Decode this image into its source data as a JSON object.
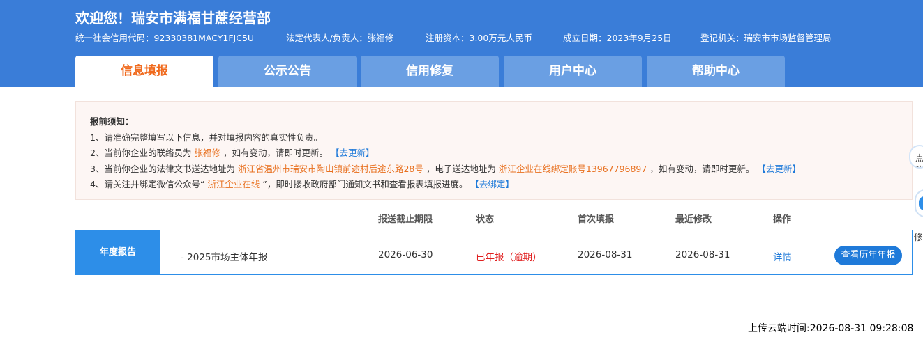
{
  "header": {
    "title": "欢迎您！瑞安市满福甘蔗经营部",
    "credit_code": "统一社会信用代码：92330381MACY1FJC5U",
    "legal_rep": "法定代表人/负责人：张福修",
    "capital": "注册资本：3.00万元人民币",
    "established": "成立日期：2023年9月25日",
    "authority": "登记机关：瑞安市市场监督管理局"
  },
  "tabs": [
    {
      "label": "信息填报",
      "active": true
    },
    {
      "label": "公示公告",
      "active": false
    },
    {
      "label": "信用修复",
      "active": false
    },
    {
      "label": "用户中心",
      "active": false
    },
    {
      "label": "帮助中心",
      "active": false
    }
  ],
  "notice": {
    "heading": "报前须知：",
    "line1": "1、请准确完整填写以下信息，并对填报内容的真实性负责。",
    "line2_prefix": "2、当前你企业的联络员为",
    "line2_name": "张福修",
    "line2_suffix": "，如有变动，请即时更新。",
    "line2_link": "【去更新】",
    "line3_prefix": "3、当前你企业的法律文书送达地址为",
    "line3_address": "浙江省温州市瑞安市陶山镇前途村后途东路28号",
    "line3_mid": "，电子送达地址为",
    "line3_eaddress": "浙江企业在线绑定账号13967796897",
    "line3_suffix": "，如有变动，请即时更新。",
    "line3_link": "【去更新】",
    "line4_prefix": "4、请关注并绑定微信公众号“",
    "line4_account": "浙江企业在线",
    "line4_suffix": "”，即时接收政府部门通知文书和查看报表填报进度。",
    "line4_link": "【去绑定】"
  },
  "table": {
    "headers": {
      "deadline": "报送截止期限",
      "status": "状态",
      "first": "首次填报",
      "last": "最近修改",
      "action": "操作"
    },
    "row": {
      "label": "年度报告",
      "name": "- 2025市场主体年报",
      "deadline": "2026-06-30",
      "status": "已年报（逾期）",
      "first": "2026-08-31",
      "last": "2026-08-31",
      "detail": "详情",
      "history": "查看历年年报"
    }
  },
  "side": {
    "badge1": "点我",
    "char": "修"
  },
  "footer": {
    "upload_time": "上传云端时间:2026-08-31 09:28:08"
  }
}
